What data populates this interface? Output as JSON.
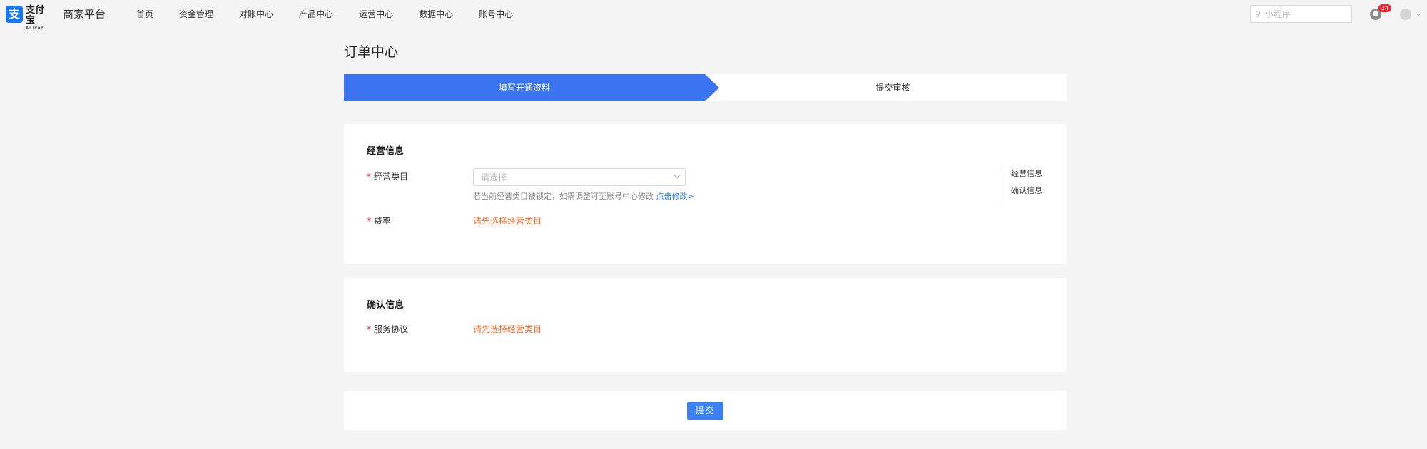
{
  "header": {
    "logo_cn": "支付宝",
    "logo_en": "ALIPAY",
    "platform": "商家平台",
    "nav": [
      "首页",
      "资金管理",
      "对账中心",
      "产品中心",
      "运营中心",
      "数据中心",
      "账号中心"
    ],
    "search_placeholder": "小程序",
    "notification_count": "24"
  },
  "page": {
    "title": "订单中心"
  },
  "steps": [
    "填写开通资料",
    "提交审核"
  ],
  "business": {
    "title": "经营信息",
    "category_label": "经营类目",
    "category_placeholder": "请选择",
    "hint": "若当前经营类目被锁定，如需调整可至账号中心修改",
    "hint_link": "点击修改>",
    "rate_label": "费率",
    "rate_value": "请先选择经营类目"
  },
  "anchor": [
    "经营信息",
    "确认信息"
  ],
  "confirm": {
    "title": "确认信息",
    "agreement_label": "服务协议",
    "agreement_value": "请先选择经营类目"
  },
  "submit_label": "提交",
  "colors": {
    "accent": "#3b82f6",
    "warning": "#fa6e2d",
    "required": "#f5222d"
  }
}
